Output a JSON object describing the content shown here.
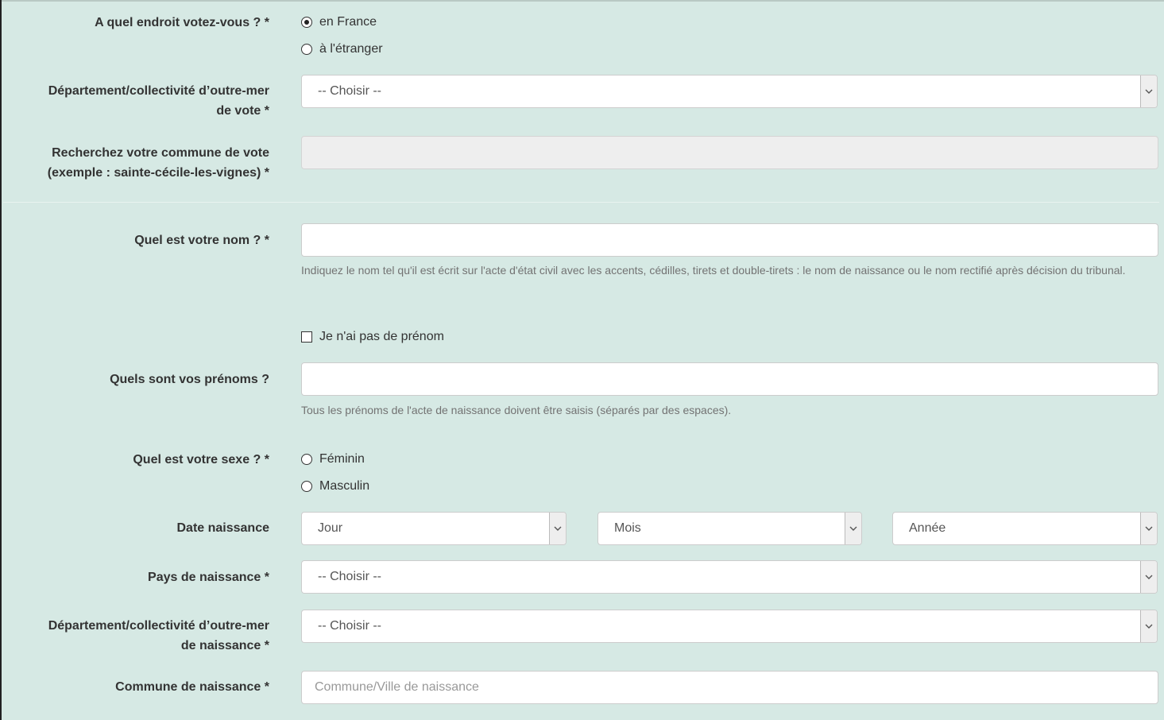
{
  "vote_location": {
    "label": "A quel endroit votez-vous ? *",
    "options": [
      {
        "label": "en France",
        "selected": true
      },
      {
        "label": "à l'étranger",
        "selected": false
      }
    ]
  },
  "department_vote": {
    "label_line1": "Département/collectivité d’outre-mer",
    "label_line2": "de vote *",
    "value": "-- Choisir --"
  },
  "commune_vote": {
    "label_line1": "Recherchez votre commune de vote",
    "label_line2": "(exemple : sainte-cécile-les-vignes) *",
    "value": ""
  },
  "nom": {
    "label": "Quel est votre nom ? *",
    "value": "",
    "help": "Indiquez le nom tel qu'il est écrit sur l'acte d'état civil avec les accents, cédilles, tirets et double-tirets : le nom de naissance ou le nom rectifié après décision du tribunal."
  },
  "no_prenom": {
    "label": "Je n'ai pas de prénom",
    "checked": false
  },
  "prenoms": {
    "label": "Quels sont vos prénoms ?",
    "value": "",
    "help": "Tous les prénoms de l'acte de naissance doivent être saisis (séparés par des espaces)."
  },
  "sexe": {
    "label": "Quel est votre sexe ? *",
    "options": [
      {
        "label": "Féminin",
        "selected": false
      },
      {
        "label": "Masculin",
        "selected": false
      }
    ]
  },
  "date_naissance": {
    "label": "Date naissance",
    "jour": "Jour",
    "mois": "Mois",
    "annee": "Année"
  },
  "pays_naissance": {
    "label": "Pays de naissance *",
    "value": "-- Choisir --"
  },
  "department_naissance": {
    "label_line1": "Département/collectivité d’outre-mer",
    "label_line2": "de naissance *",
    "value": "-- Choisir --"
  },
  "commune_naissance": {
    "label": "Commune de naissance *",
    "placeholder": "Commune/Ville de naissance"
  },
  "icons": {
    "select_arrow": "chevron-down-icon"
  },
  "colors": {
    "background": "#d6e9e4",
    "help_text": "#737373",
    "disabled_input": "#eeeeee"
  }
}
